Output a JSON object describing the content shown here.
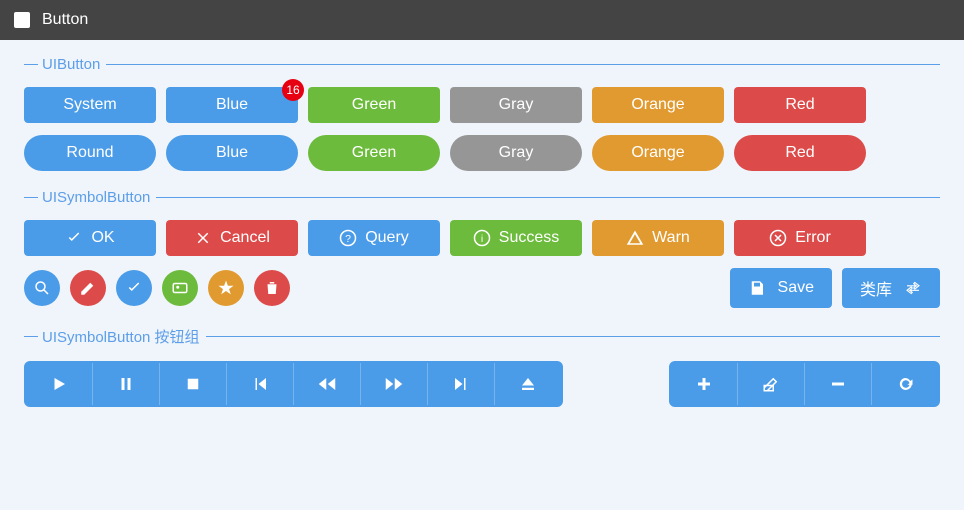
{
  "title": "Button",
  "sections": {
    "s1": "UIButton",
    "s2": "UISymbolButton",
    "s3": "UISymbolButton 按钮组"
  },
  "row1": [
    "System",
    "Blue",
    "Green",
    "Gray",
    "Orange",
    "Red"
  ],
  "badge": "16",
  "row2": [
    "Round",
    "Blue",
    "Green",
    "Gray",
    "Orange",
    "Red"
  ],
  "sym": [
    "OK",
    "Cancel",
    "Query",
    "Success",
    "Warn",
    "Error"
  ],
  "save": "Save",
  "lib": "类库"
}
